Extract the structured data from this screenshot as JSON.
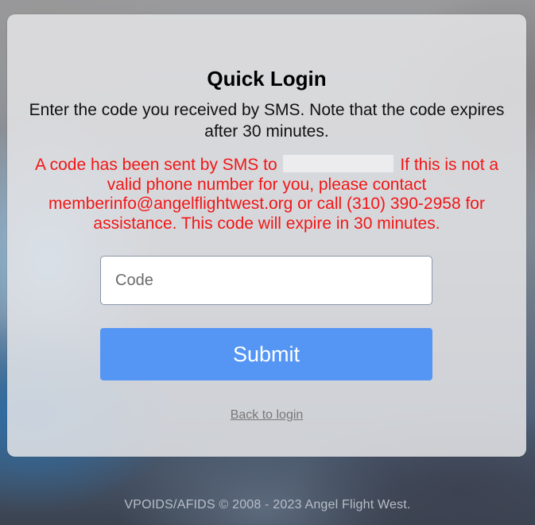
{
  "login": {
    "title": "Quick Login",
    "intro": "Enter the code you received by SMS. Note that the code expires after 30 minutes.",
    "alert_before": "A code has been sent by SMS to",
    "alert_after": "If this is not a valid phone number for you, please contact memberinfo@angelflightwest.org or call (310) 390-2958 for assistance. This code will expire in 30 minutes.",
    "code_placeholder": "Code",
    "code_value": "",
    "submit_label": "Submit",
    "back_label": "Back to login"
  },
  "footer": {
    "text": "VPOIDS/AFIDS © 2008 - 2023 Angel Flight West."
  },
  "colors": {
    "alert": "#f21616",
    "button": "#5596f5",
    "card": "#e4e4e6"
  }
}
